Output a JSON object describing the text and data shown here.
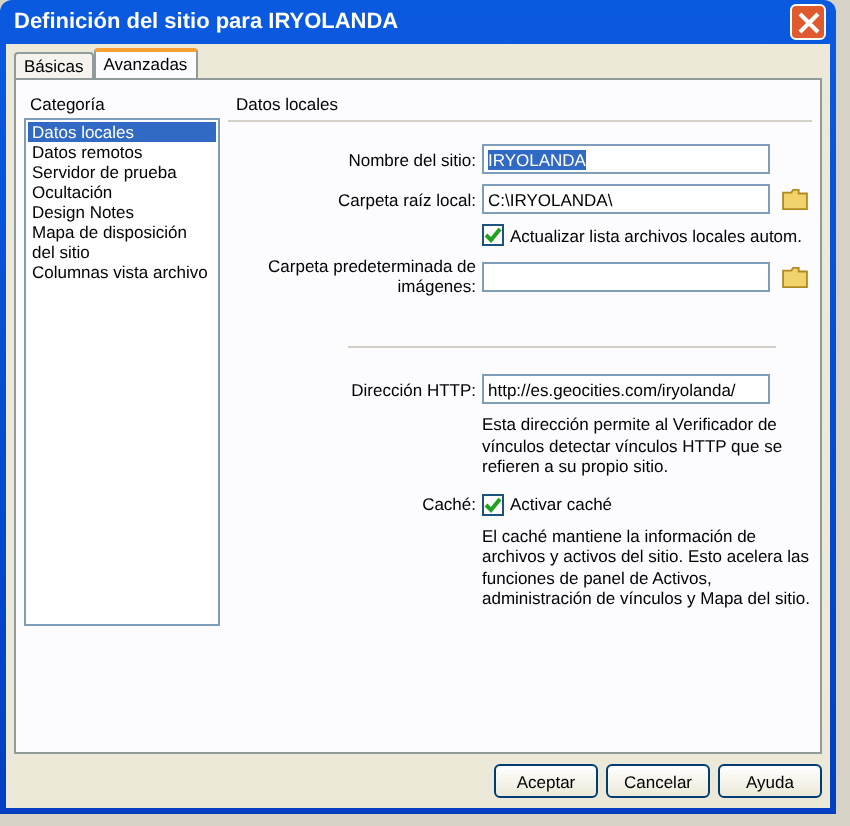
{
  "window": {
    "title": "Definición del sitio para IRYOLANDA"
  },
  "tabs": [
    {
      "label": "Básicas",
      "selected": false
    },
    {
      "label": "Avanzadas",
      "selected": true
    }
  ],
  "sidebar": {
    "title": "Categoría",
    "items": [
      {
        "label": "Datos locales",
        "selected": true
      },
      {
        "label": "Datos remotos",
        "selected": false
      },
      {
        "label": "Servidor de prueba",
        "selected": false
      },
      {
        "label": "Ocultación",
        "selected": false
      },
      {
        "label": "Design Notes",
        "selected": false
      },
      {
        "label": "Mapa de disposición del sitio",
        "selected": false
      },
      {
        "label": "Columnas vista archivo",
        "selected": false
      }
    ]
  },
  "panel": {
    "title": "Datos locales",
    "rows": [
      {
        "kind": "field",
        "label": "Nombre del sitio:",
        "value": "IRYOLANDA",
        "highlighted": true,
        "browse": false
      },
      {
        "kind": "field",
        "label": "Carpeta raíz local:",
        "value": "C:\\IRYOLANDA\\",
        "highlighted": false,
        "browse": true
      },
      {
        "kind": "checkbox",
        "text": "Actualizar lista archivos locales autom.",
        "checked": true
      },
      {
        "kind": "field",
        "label": "Carpeta predeterminada de imágenes:",
        "value": "",
        "browse": true
      },
      {
        "kind": "separator"
      },
      {
        "kind": "field",
        "label": "Dirección HTTP:",
        "value": "http://es.geocities.com/iryolanda/",
        "highlighted": false,
        "browse": false
      },
      {
        "kind": "description",
        "text": "Esta dirección permite al Verificador de vínculos detectar vínculos HTTP que se refieren a su propio sitio."
      },
      {
        "kind": "checkbox",
        "label": "Caché:",
        "text": "Activar caché",
        "checked": true
      },
      {
        "kind": "description",
        "text": "El caché mantiene la información de archivos y activos del sitio. Esto acelera las funciones de panel de Activos, administración de vínculos y Mapa del sitio."
      }
    ]
  },
  "buttons": [
    "Aceptar",
    "Cancelar",
    "Ayuda"
  ]
}
